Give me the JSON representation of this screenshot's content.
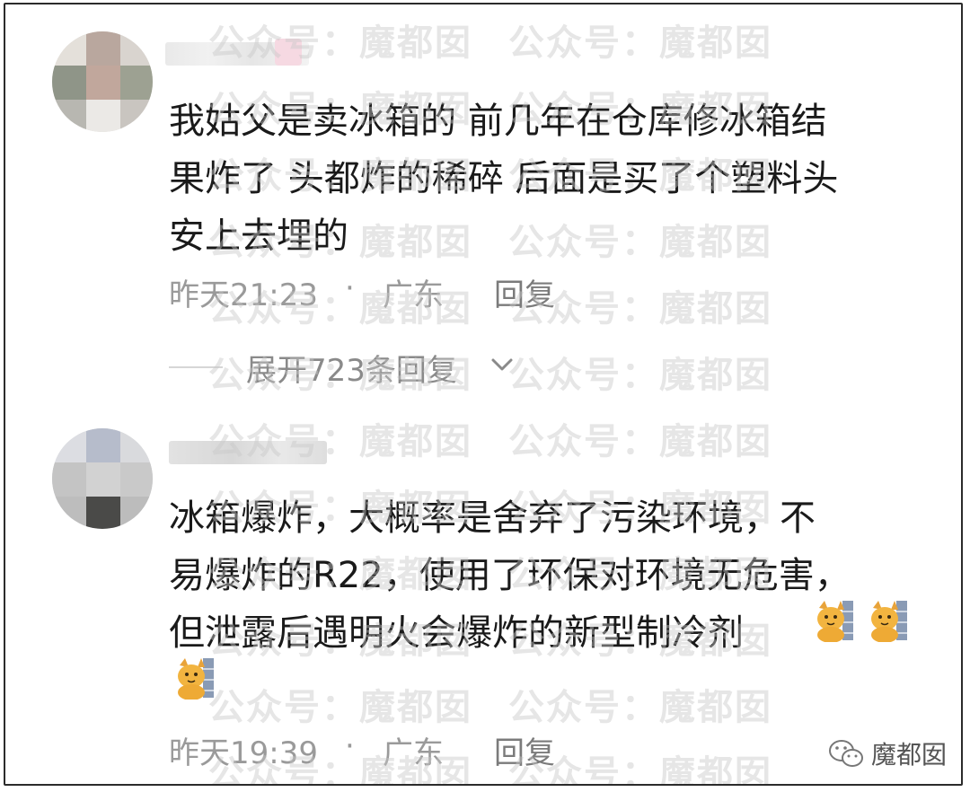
{
  "comments": [
    {
      "text_lines": [
        "我姑父是卖冰箱的 前几年在仓库修冰箱结",
        "果炸了 头都炸的稀碎 后面是买了个塑料头",
        "安上去埋的"
      ],
      "time": "昨天21:23",
      "dot": "·",
      "location": "广东",
      "reply_label": "回复",
      "expand_label": "展开723条回复"
    },
    {
      "text_lines": [
        "冰箱爆炸，大概率是舍弃了污染环境，不",
        "易爆炸的R22，使用了环保对环境无危害，",
        "但泄露后遇明火会爆炸的新型制冷剂"
      ],
      "emoji_icons": [
        "cat-icon",
        "cat-icon",
        "cat-icon"
      ],
      "time": "昨天19:39",
      "dot": "·",
      "location": "广东",
      "reply_label": "回复"
    }
  ],
  "watermark": {
    "text": "公众号：魔都囡"
  },
  "brand": {
    "icon": "wechat-icon",
    "name": "魔都囡"
  }
}
